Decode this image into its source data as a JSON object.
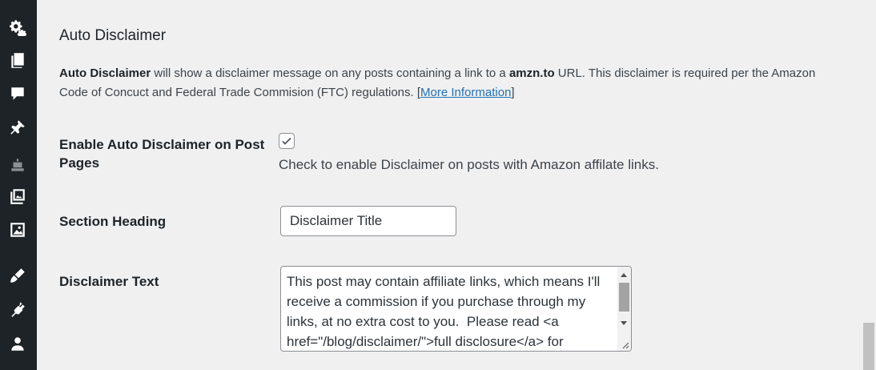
{
  "sidebar": {
    "icons": [
      "settings-icon",
      "pages-icon",
      "comments-icon",
      "pin-icon",
      "robot-icon",
      "gallery-icon",
      "image-icon",
      "brush-icon",
      "plugin-icon",
      "user-icon"
    ]
  },
  "section": {
    "title": "Auto Disclaimer",
    "desc_strong1": "Auto Disclaimer",
    "desc_text1": " will show a disclaimer message on any posts containing a link to a ",
    "desc_strong2": "amzn.to",
    "desc_text2": " URL. This disclaimer is required per the Amazon Code of Concuct and Federal Trade Commision (FTC) regulations. [",
    "desc_link": "More Information",
    "desc_text3": "]"
  },
  "fields": {
    "enable_label": "Enable Auto Disclaimer on Post Pages",
    "enable_checked": true,
    "enable_desc": "Check to enable Disclaimer on posts with Amazon affilate links.",
    "heading_label": "Section Heading",
    "heading_value": "Disclaimer Title",
    "text_label": "Disclaimer Text",
    "text_value": "This post may contain affiliate links, which means I'll receive a commission if you purchase through my links, at no extra cost to you.  Please read <a href=\"/blog/disclaimer/\">full disclosure</a> for"
  }
}
